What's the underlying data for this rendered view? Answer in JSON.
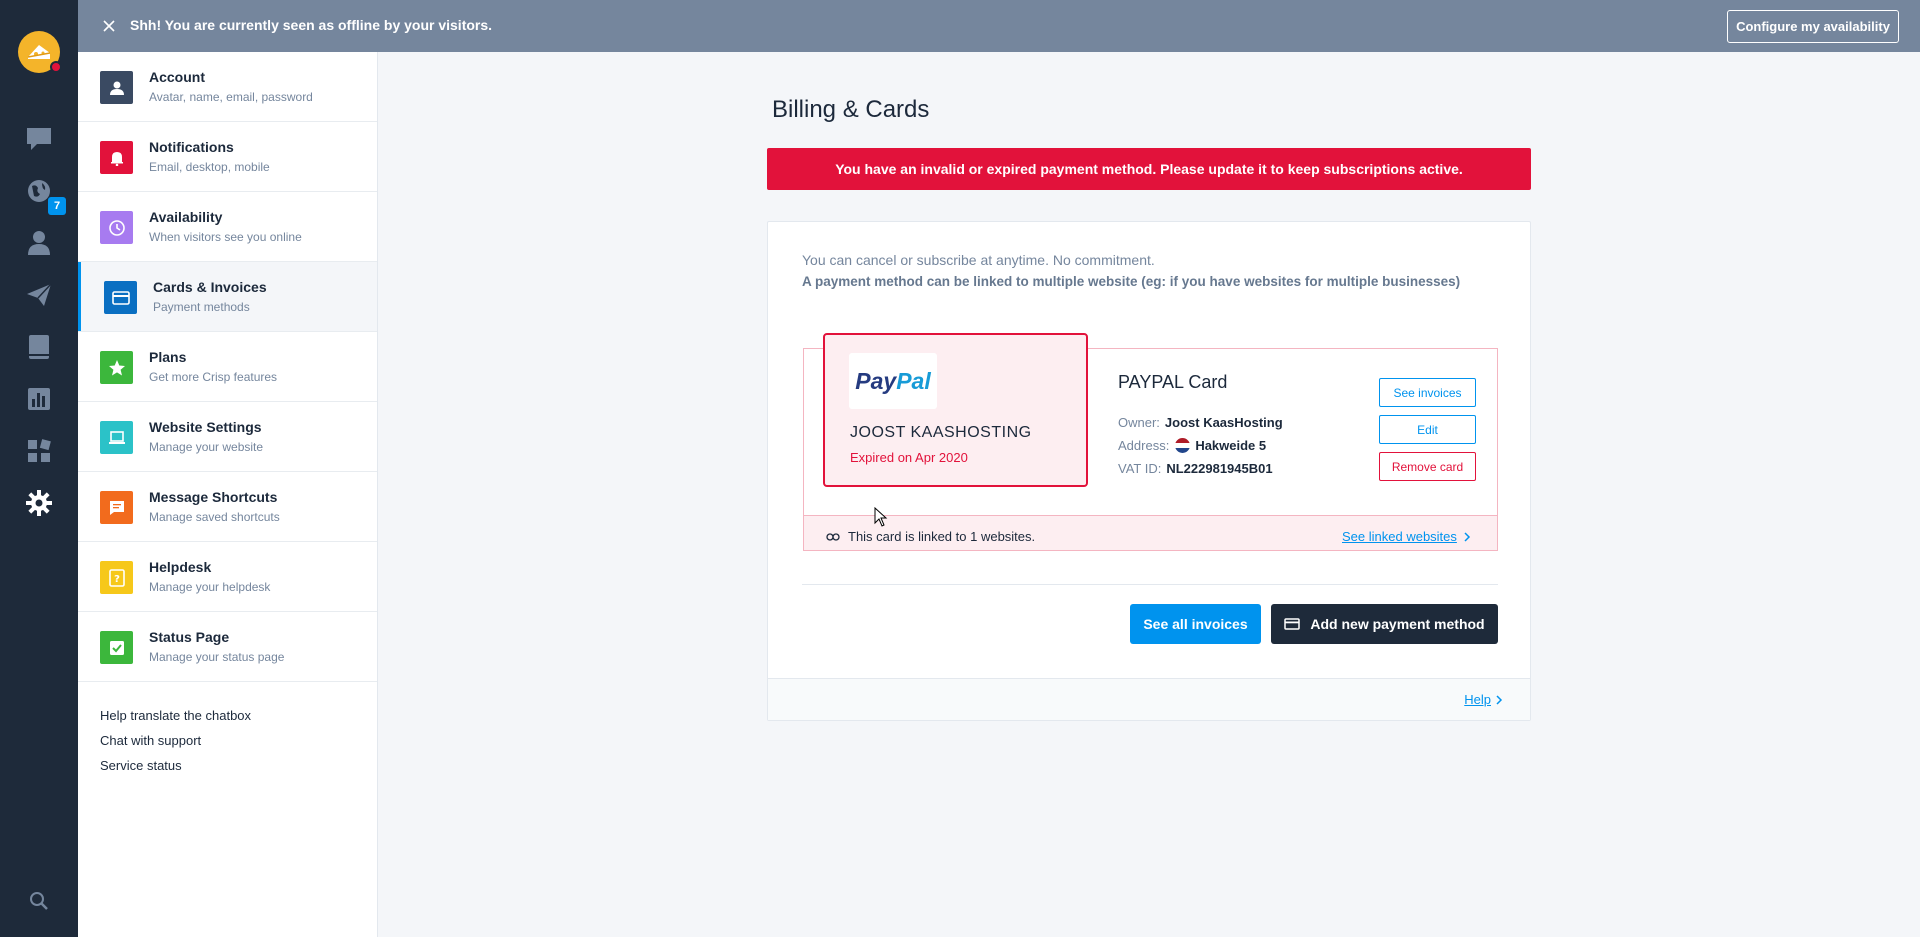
{
  "colors": {
    "rail_bg": "#1e2a3a",
    "topbar_bg": "#75869d",
    "accent_blue": "#0093ee",
    "alert_red": "#e2123b",
    "dark": "#1c293b"
  },
  "rail": {
    "badge": "7",
    "icons": [
      "chat-icon",
      "globe-icon",
      "user-icon",
      "paper-plane-icon",
      "book-icon",
      "chart-icon",
      "plugins-icon",
      "gear-icon",
      "search-icon"
    ]
  },
  "topbar": {
    "message": "Shh! You are currently seen as offline by your visitors.",
    "configure_button": "Configure my availability"
  },
  "sidebar": {
    "items": [
      {
        "title": "Account",
        "subtitle": "Avatar, name, email, password",
        "color": "#3a4a62"
      },
      {
        "title": "Notifications",
        "subtitle": "Email, desktop, mobile",
        "color": "#e2123b"
      },
      {
        "title": "Availability",
        "subtitle": "When visitors see you online",
        "color": "#a77bf0"
      },
      {
        "title": "Cards & Invoices",
        "subtitle": "Payment methods",
        "color": "#0a6fc2"
      },
      {
        "title": "Plans",
        "subtitle": "Get more Crisp features",
        "color": "#3cb73c"
      },
      {
        "title": "Website Settings",
        "subtitle": "Manage your website",
        "color": "#2bc2c8"
      },
      {
        "title": "Message Shortcuts",
        "subtitle": "Manage saved shortcuts",
        "color": "#f26b1d"
      },
      {
        "title": "Helpdesk",
        "subtitle": "Manage your helpdesk",
        "color": "#f6c81a"
      },
      {
        "title": "Status Page",
        "subtitle": "Manage your status page",
        "color": "#3cb73c"
      }
    ],
    "links": [
      "Help translate the chatbox",
      "Chat with support",
      "Service status"
    ]
  },
  "main": {
    "title": "Billing & Cards",
    "alert": "You have an invalid or expired payment method. Please update it to keep subscriptions active.",
    "intro_line1": "You can cancel or subscribe at anytime. No commitment.",
    "intro_line2": "A payment method can be linked to multiple website (eg: if you have websites for multiple businesses)",
    "card": {
      "logo_part1": "Pay",
      "logo_part2": "Pal",
      "holder": "JOOST KAASHOSTING",
      "expiry": "Expired on Apr 2020",
      "type_title": "PAYPAL Card",
      "owner_label": "Owner:",
      "owner_value": "Joost KaasHosting",
      "address_label": "Address:",
      "address_value": "Hakweide 5",
      "vat_label": "VAT ID:",
      "vat_value": "NL222981945B01",
      "see_invoices": "See invoices",
      "edit": "Edit",
      "remove": "Remove card",
      "linked_text": "This card is linked to 1 websites.",
      "see_linked": "See linked websites"
    },
    "see_all_invoices": "See all invoices",
    "add_payment": "Add new payment method",
    "help": "Help"
  }
}
